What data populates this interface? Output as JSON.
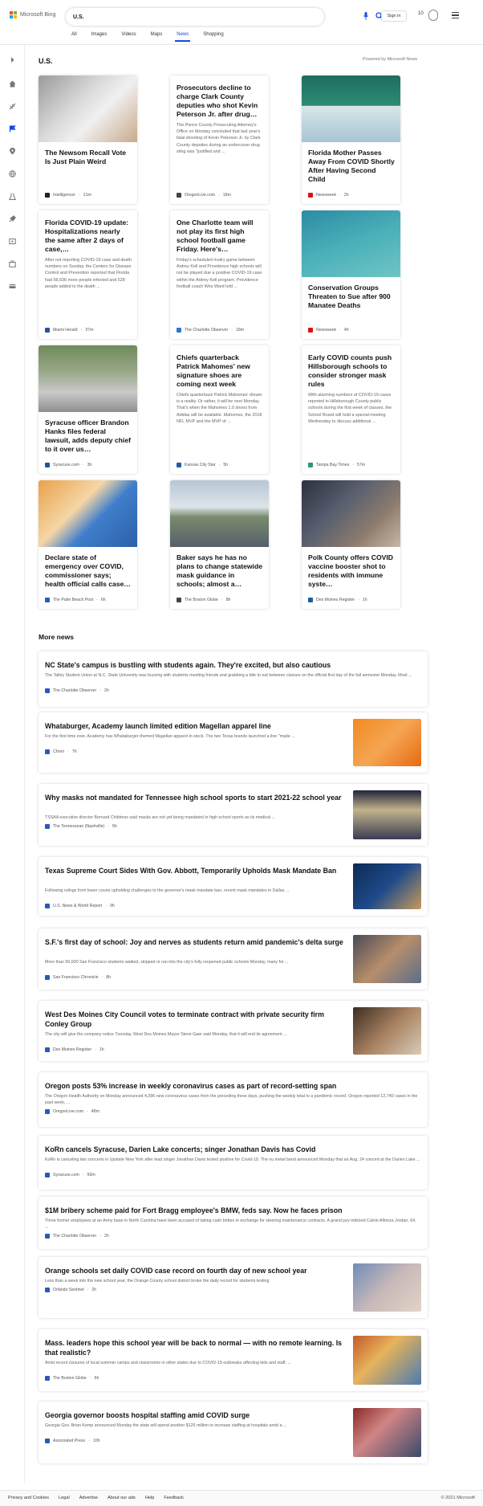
{
  "header": {
    "logo_text": "Microsoft Bing",
    "search_value": "U.S.",
    "signin_label": "Sign in",
    "rewards_count": "10"
  },
  "tabs": [
    {
      "label": "All"
    },
    {
      "label": "Images"
    },
    {
      "label": "Videos"
    },
    {
      "label": "Maps"
    },
    {
      "label": "News",
      "active": true
    },
    {
      "label": "Shopping"
    }
  ],
  "section": {
    "title": "U.S.",
    "powered": "Powered by Microsoft News"
  },
  "cards": [
    {
      "title": "The Newsom Recall Vote Is Just Plain Weird",
      "snippet": "",
      "source": "Intelligencer",
      "time": "21m",
      "has_image": true
    },
    {
      "title": "Prosecutors decline to charge Clark County deputies who shot Kevin Peterson Jr. after drug…",
      "snippet": "The Pierce County Prosecuting Attorney's Office on Monday concluded that last year's fatal shooting of Kevin Peterson Jr. by Clark County deputies during an undercover drug sting was \"justified and ...",
      "source": "OregonLive.com",
      "time": "18m",
      "has_image": false
    },
    {
      "title": "Florida Mother Passes Away From COVID Shortly After Having Second Child",
      "snippet": "",
      "source": "Newsweek",
      "time": "2h",
      "has_image": true
    },
    {
      "title": "Florida COVID-19 update: Hospitalizations nearly the same after 2 days of case,…",
      "snippet": "After not reporting COVID-19 case and death numbers on Sunday, the Centers for Disease Control and Prevention reported that Florida had 56,036 more people infected and 528 people added to the death ...",
      "source": "Miami Herald",
      "time": "37m",
      "has_image": false
    },
    {
      "title": "One Charlotte team will not play its first high school football game Friday. Here's…",
      "snippet": "Friday's scheduled rivalry game between Ardrey Kell and Providence high schools will not be played due a positive COVID-19 case within the Ardrey Kell program. Providence football coach Wes Ward told ...",
      "source": "The Charlotte Observer",
      "time": "18m",
      "has_image": false
    },
    {
      "title": "Conservation Groups Threaten to Sue after 900 Manatee Deaths",
      "snippet": "",
      "source": "Newsweek",
      "time": "4h",
      "has_image": true
    },
    {
      "title": "Syracuse officer Brandon Hanks files federal lawsuit, adds deputy chief to it over us…",
      "snippet": "",
      "source": "Syracuse.com",
      "time": "3h",
      "has_image": true
    },
    {
      "title": "Chiefs quarterback Patrick Mahomes' new signature shoes are coming next week",
      "snippet": "Chiefs quarterback Patrick Mahomes' dream is a reality. Or rather, it will be next Monday. That's when the Mahomes 1.0 shoes from Adidas will be available. Mahomes, the 2018 NFL MVP and the MVP of ...",
      "source": "Kansas City Star",
      "time": "5h",
      "has_image": false
    },
    {
      "title": "Early COVID counts push Hillsborough schools to consider stronger mask rules",
      "snippet": "With alarming numbers of COVID-19 cases reported in Hillsborough County public schools during the first week of classes, the School Board will hold a special meeting Wednesday to discuss additional ...",
      "source": "Tampa Bay Times",
      "time": "57m",
      "has_image": false
    },
    {
      "title": "Declare state of emergency over COVID, commissioner says; health official calls case…",
      "snippet": "",
      "source": "The Palm Beach Post",
      "time": "6h",
      "has_image": true
    },
    {
      "title": "Baker says he has no plans to change statewide mask guidance in schools; almost a…",
      "snippet": "",
      "source": "The Boston Globe",
      "time": "8h",
      "has_image": true
    },
    {
      "title": "Polk County offers COVID vaccine booster shot to residents with immune syste…",
      "snippet": "",
      "source": "Des Moines Register",
      "time": "1h",
      "has_image": true
    }
  ],
  "more": {
    "title": "More news",
    "items": [
      {
        "title": "NC State's campus is bustling with students again. They're excited, but also cautious",
        "snippet": "The Talley Student Union at N.C. State University was buzzing with students meeting friends and grabbing a bite to eat between classes on the official first day of the fall semester Monday. Most ...",
        "source": "The Charlotte Observer",
        "time": "2h",
        "has_image": false
      },
      {
        "title": "Whataburger, Academy launch limited edition Magellan apparel line",
        "snippet": "For the first time ever, Academy has Whataburger-themed Magellan apparel in stock. The two Texas brands launched a line \"made ...",
        "source": "Chron",
        "time": "7h",
        "has_image": true
      },
      {
        "title": "Why masks not mandated for Tennessee high school sports to start 2021-22 school year",
        "snippet": "TSSAA executive director Bernard Childress said masks are not yet being mandated in high school sports as its medical ...",
        "source": "The Tennessean (Nashville)",
        "time": "5h",
        "has_image": true
      },
      {
        "title": "Texas Supreme Court Sides With Gov. Abbott, Temporarily Upholds Mask Mandate Ban",
        "snippet": "Following rulings from lower courts upholding challenges to the governor's mask mandate ban, recent mask mandates in Dallas ...",
        "source": "U.S. News & World Report",
        "time": "9h",
        "has_image": true
      },
      {
        "title": "S.F.'s first day of school: Joy and nerves as students return amid pandemic's delta surge",
        "snippet": "More than 50,000 San Francisco students walked, skipped or ran into the city's fully reopened public schools Monday, many for ...",
        "source": "San Francisco Chronicle",
        "time": "8h",
        "has_image": true
      },
      {
        "title": "West Des Moines City Council votes to terminate contract with private security firm Conley Group",
        "snippet": "The city will give the company notice Tuesday, West Des Moines Mayor Steve Gaer said Monday, that it will end its agreement ...",
        "source": "Des Moines Register",
        "time": "1h",
        "has_image": true
      },
      {
        "title": "Oregon posts 53% increase in weekly coronavirus cases as part of record-setting span",
        "snippet": "The Oregon Health Authority on Monday announced 4,396 new coronavirus cases from the preceding three days, pushing the weekly total to a pandemic record. Oregon reported 12,740 cases in the past week, ...",
        "source": "OregonLive.com",
        "time": "48m",
        "has_image": false
      },
      {
        "title": "KoRn cancels Syracuse, Darien Lake concerts; singer Jonathan Davis has Covid",
        "snippet": "KoRn is canceling two concerts in Upstate New York after lead singer Jonathan Davis tested positive for Covid-19. The nu metal band announced Monday that an Aug. 24 concert at the Darien Lake ...",
        "source": "Syracuse.com",
        "time": "50m",
        "has_image": false
      },
      {
        "title": "$1M bribery scheme paid for Fort Bragg employee's BMW, feds say. Now he faces prison",
        "snippet": "Three former employees at an Army base in North Carolina have been accused of taking cash bribes in exchange for steering maintenance contracts. A grand jury indicted Calvin Alfonza Jordan, 64, ...",
        "source": "The Charlotte Observer",
        "time": "2h",
        "has_image": false
      },
      {
        "title": "Orange schools set daily COVID case record on fourth day of new school year",
        "snippet": "Less than a week into the new school year, the Orange County school district broke the daily record for students testing",
        "source": "Orlando Sentinel",
        "time": "2h",
        "has_image": true
      },
      {
        "title": "Mass. leaders hope this school year will be back to normal — with no remote learning. Is that realistic?",
        "snippet": "Amid recent closures of local summer camps and classrooms in other states due to COVID-19 outbreaks affecting kids and staff, ...",
        "source": "The Boston Globe",
        "time": "6h",
        "has_image": true
      },
      {
        "title": "Georgia governor boosts hospital staffing amid COVID surge",
        "snippet": "Georgia Gov. Brian Kemp announced Monday the state will spend another $125 million to increase staffing at hospitals amid a ...",
        "source": "Associated Press",
        "time": "10h",
        "has_image": true
      }
    ]
  },
  "footer": {
    "links": [
      {
        "label": "Privacy and Cookies"
      },
      {
        "label": "Legal"
      },
      {
        "label": "Advertise"
      },
      {
        "label": "About our ads"
      },
      {
        "label": "Help"
      },
      {
        "label": "Feedback"
      }
    ],
    "copyright": "© 2021 Microsoft"
  },
  "colors": {
    "accent": "#174ae4",
    "card_shadow": "#d8d8d8"
  },
  "icons": {
    "sidebar": [
      "expand-icon",
      "home-icon",
      "sports-icon",
      "politics-icon",
      "local-icon",
      "world-icon",
      "science-icon",
      "technology-icon",
      "entertainment-icon",
      "business-icon",
      "money-icon"
    ]
  }
}
